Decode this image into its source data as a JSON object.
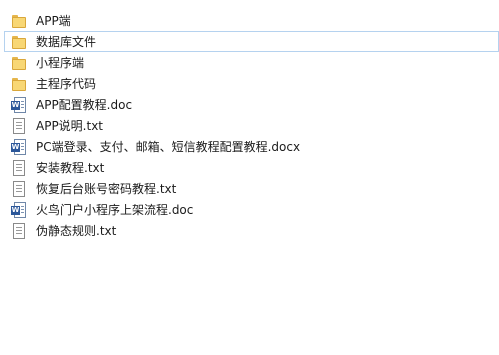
{
  "items": [
    {
      "name": "APP端",
      "type": "folder",
      "selected": false
    },
    {
      "name": "数据库文件",
      "type": "folder",
      "selected": true
    },
    {
      "name": "小程序端",
      "type": "folder",
      "selected": false
    },
    {
      "name": "主程序代码",
      "type": "folder",
      "selected": false
    },
    {
      "name": "APP配置教程.doc",
      "type": "doc",
      "selected": false
    },
    {
      "name": "APP说明.txt",
      "type": "txt",
      "selected": false
    },
    {
      "name": "PC端登录、支付、邮箱、短信教程配置教程.docx",
      "type": "doc",
      "selected": false
    },
    {
      "name": "安装教程.txt",
      "type": "txt",
      "selected": false
    },
    {
      "name": "恢复后台账号密码教程.txt",
      "type": "txt",
      "selected": false
    },
    {
      "name": "火鸟门户小程序上架流程.doc",
      "type": "doc",
      "selected": false
    },
    {
      "name": "伪静态规则.txt",
      "type": "txt",
      "selected": false
    }
  ],
  "icons": {
    "folder": "folder-icon",
    "txt": "text-file-icon",
    "doc": "word-document-icon",
    "doc_badge": "W"
  },
  "colors": {
    "selection_border": "#b5d2ef",
    "folder": "#f8d775",
    "word": "#2b579a"
  }
}
